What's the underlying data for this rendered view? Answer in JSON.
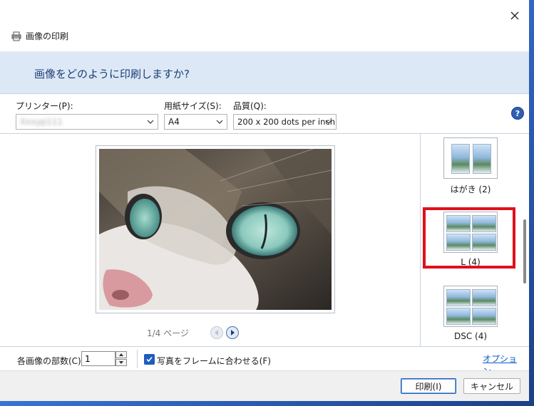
{
  "window": {
    "title": "画像の印刷"
  },
  "header": {
    "question": "画像をどのように印刷しますか?"
  },
  "controls": {
    "printer_label": "プリンター(P):",
    "printer_value": "Xxxyp111",
    "paper_label": "用紙サイズ(S):",
    "paper_value": "A4",
    "quality_label": "品質(Q):",
    "quality_value": "200 x 200 dots per inch"
  },
  "preview": {
    "page_indicator": "1/4 ページ"
  },
  "layouts": [
    {
      "label": "はがき (2)"
    },
    {
      "label": "L (4)"
    },
    {
      "label": "DSC (4)"
    }
  ],
  "bottom": {
    "copies_label": "各画像の部数(C):",
    "copies_value": "1",
    "fit_label": "写真をフレームに合わせる(F)",
    "fit_checked": true,
    "options_link": "オプション..."
  },
  "footer": {
    "print_label": "印刷(I)",
    "cancel_label": "キャンセル"
  },
  "colors": {
    "accent": "#1f5cc0",
    "highlight": "#e0101c",
    "header_band": "#dce8f5"
  }
}
